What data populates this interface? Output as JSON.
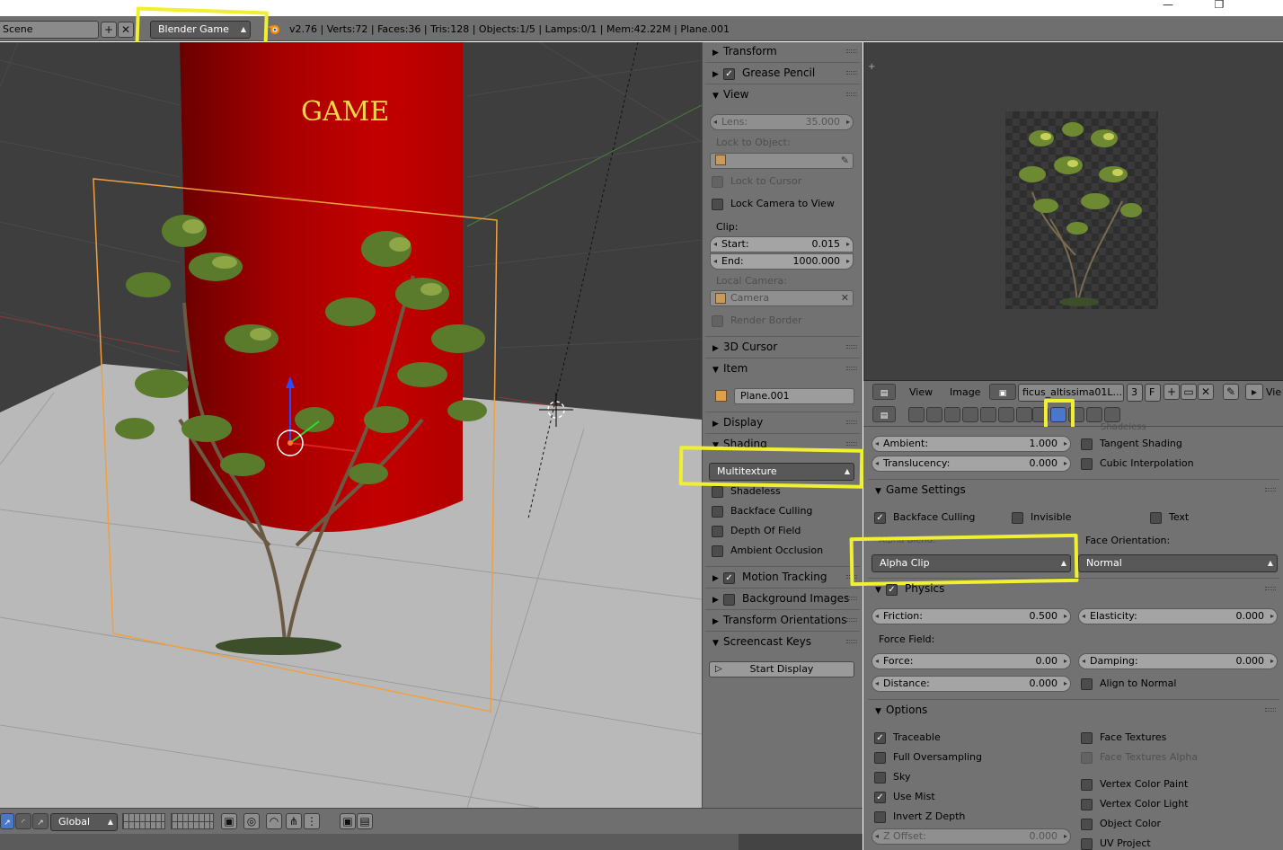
{
  "window": {
    "minimize": "—",
    "maximize": "❐"
  },
  "info_header": {
    "scene": "Scene",
    "engine": "Blender Game",
    "stats": "v2.76 | Verts:72 | Faces:36 | Tris:128 | Objects:1/5 | Lamps:0/1 | Mem:42.22M | Plane.001"
  },
  "viewport": {
    "overlay_text": "GAME",
    "header": {
      "orientation": "Global"
    }
  },
  "npanel": {
    "transform": "Transform",
    "grease_pencil": "Grease Pencil",
    "view": "View",
    "lens_label": "Lens:",
    "lens_value": "35.000",
    "lock_to_object": "Lock to Object:",
    "lock_to_cursor": "Lock to Cursor",
    "lock_camera": "Lock Camera to View",
    "clip": "Clip:",
    "start_label": "Start:",
    "start_value": "0.015",
    "end_label": "End:",
    "end_value": "1000.000",
    "local_camera": "Local Camera:",
    "camera": "Camera",
    "render_border": "Render Border",
    "cursor_3d": "3D Cursor",
    "item": "Item",
    "item_name": "Plane.001",
    "display": "Display",
    "shading": "Shading",
    "shading_mode": "Multitexture",
    "shadeless": "Shadeless",
    "backface_culling": "Backface Culling",
    "depth_of_field": "Depth Of Field",
    "ambient_occlusion": "Ambient Occlusion",
    "motion_tracking": "Motion Tracking",
    "background_images": "Background Images",
    "transform_orientations": "Transform Orientations",
    "screencast_keys": "Screencast Keys",
    "start_display": "Start Display"
  },
  "image_header": {
    "view": "View",
    "image": "Image",
    "image_name": "ficus_altissima01L....",
    "users": "3",
    "fake": "F",
    "view_right": "Vie"
  },
  "props": {
    "shadeless_cut": "Shadeless",
    "ambient_label": "Ambient:",
    "ambient_value": "1.000",
    "translucency_label": "Translucency:",
    "translucency_value": "0.000",
    "tangent_shading": "Tangent Shading",
    "cubic_interpolation": "Cubic Interpolation",
    "game_settings": "Game Settings",
    "backface_culling": "Backface Culling",
    "invisible": "Invisible",
    "text": "Text",
    "alpha_blend": "Alpha Blend:",
    "alpha_clip": "Alpha Clip",
    "face_orientation": "Face Orientation:",
    "normal": "Normal",
    "physics": "Physics",
    "friction_label": "Friction:",
    "friction_value": "0.500",
    "elasticity_label": "Elasticity:",
    "elasticity_value": "0.000",
    "force_field": "Force Field:",
    "force_label": "Force:",
    "force_value": "0.00",
    "damping_label": "Damping:",
    "damping_value": "0.000",
    "distance_label": "Distance:",
    "distance_value": "0.000",
    "align_to_normal": "Align to Normal",
    "options": "Options",
    "traceable": "Traceable",
    "full_oversampling": "Full Oversampling",
    "sky": "Sky",
    "use_mist": "Use Mist",
    "invert_z": "Invert Z Depth",
    "z_offset_label": "Z Offset:",
    "z_offset_value": "0.000",
    "face_textures": "Face Textures",
    "face_textures_alpha": "Face Textures Alpha",
    "vertex_color_paint": "Vertex Color Paint",
    "vertex_color_light": "Vertex Color Light",
    "object_color": "Object Color",
    "uv_project": "UV Project"
  },
  "colors": {
    "highlight": "#f0f030",
    "selection_orange": "#f0a040",
    "cylinder_red": "#b30000"
  }
}
